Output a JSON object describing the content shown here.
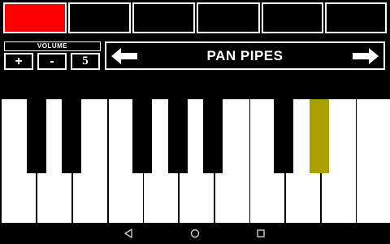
{
  "presets": [
    {
      "active": true
    },
    {
      "active": false
    },
    {
      "active": false
    },
    {
      "active": false
    },
    {
      "active": false
    },
    {
      "active": false
    }
  ],
  "volume": {
    "title": "VOLUME",
    "plus_label": "+",
    "minus_label": "-",
    "value": "5"
  },
  "instrument": {
    "name": "PAN PIPES",
    "prev_icon": "arrow-left-icon",
    "next_icon": "arrow-right-icon"
  },
  "piano": {
    "white_key_count": 11,
    "black_keys": [
      {
        "note": "C#",
        "active": false
      },
      {
        "note": "D#",
        "active": false
      },
      {
        "note": "F#",
        "active": false
      },
      {
        "note": "G#",
        "active": false
      },
      {
        "note": "A#",
        "active": false
      },
      {
        "note": "C#",
        "active": false
      },
      {
        "note": "D#",
        "active": true
      }
    ],
    "active_color": "#aaa000"
  },
  "preset_active_color": "#ff0000",
  "navbar": {
    "back_icon": "back-triangle-icon",
    "home_icon": "home-circle-icon",
    "recents_icon": "recents-square-icon"
  }
}
